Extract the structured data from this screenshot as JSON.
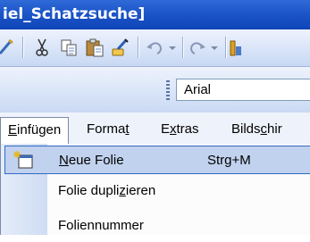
{
  "window": {
    "title": "iel_Schatzsuche]"
  },
  "standard_toolbar": {
    "buttons": [
      "spelling-icon",
      "cut-icon",
      "copy-icon",
      "paste-icon",
      "format-painter-icon",
      "undo-icon",
      "redo-icon",
      "chart-icon"
    ]
  },
  "formatting_toolbar": {
    "font_name": "Arial"
  },
  "menubar": {
    "items": [
      {
        "label": "Einfügen",
        "pre": "",
        "key": "E",
        "post": "infügen"
      },
      {
        "label": "Format",
        "pre": "Forma",
        "key": "t",
        "post": ""
      },
      {
        "label": "Extras",
        "pre": "E",
        "key": "x",
        "post": "tras"
      },
      {
        "label": "Bildschirm",
        "pre": "Bilds",
        "key": "c",
        "post": "hir"
      }
    ]
  },
  "insert_menu": {
    "items": [
      {
        "label": "Neue Folie",
        "pre": "",
        "key": "N",
        "post": "eue Folie",
        "shortcut": "Strg+M",
        "icon": "new-slide-icon",
        "highlighted": true
      },
      {
        "label": "Folie duplizieren",
        "pre": "Folie dupli",
        "key": "z",
        "post": "ieren",
        "shortcut": ""
      },
      {
        "label": "Foliennummer",
        "pre": "Foliennummer",
        "key": "",
        "post": "",
        "shortcut": ""
      }
    ]
  },
  "colors": {
    "titlebar": "#1c55c8",
    "highlight": "#c1d2ee",
    "highlight_border": "#316ac5"
  }
}
